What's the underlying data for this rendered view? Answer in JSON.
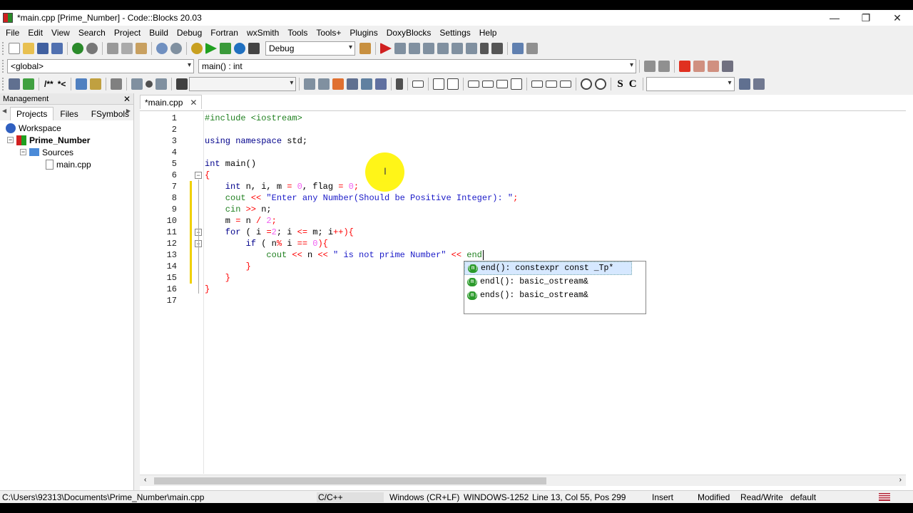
{
  "window": {
    "title": "*main.cpp [Prime_Number] - Code::Blocks 20.03",
    "minimize_icon": "—",
    "restore_icon": "❐",
    "close_icon": "✕"
  },
  "menu": [
    "File",
    "Edit",
    "View",
    "Search",
    "Project",
    "Build",
    "Debug",
    "Fortran",
    "wxSmith",
    "Tools",
    "Tools+",
    "Plugins",
    "DoxyBlocks",
    "Settings",
    "Help"
  ],
  "toolbar": {
    "build_target": "Debug",
    "scope": "<global>",
    "function": "main() : int",
    "doxy_text_1": "/**",
    "doxy_text_2": "*<",
    "bold_s": "S",
    "bold_c": "C"
  },
  "management": {
    "title": "Management",
    "close": "✕",
    "tabs": [
      "Projects",
      "Files",
      "FSymbols"
    ],
    "tree": {
      "workspace": "Workspace",
      "project": "Prime_Number",
      "sources": "Sources",
      "file": "main.cpp"
    }
  },
  "editor": {
    "tab_label": "*main.cpp",
    "tab_close": "✕",
    "line_numbers": [
      "1",
      "2",
      "3",
      "4",
      "5",
      "6",
      "7",
      "8",
      "9",
      "10",
      "11",
      "12",
      "13",
      "14",
      "15",
      "16",
      "17"
    ],
    "code": {
      "l1": "#include <iostream>",
      "l3a": "using namespace",
      "l3b": " std;",
      "l5a": "int",
      "l5b": " main()",
      "l6": "{",
      "l7a": "    int",
      "l7b": " n, i, m ",
      "l7c": "=",
      "l7d": " 0",
      "l7e": ", flag ",
      "l7f": "=",
      "l7g": " 0",
      "l7h": ";",
      "l8a": "    cout ",
      "l8b": "<<",
      "l8c": " \"Enter any Number(Should be Positive Integer): \"",
      "l8d": ";",
      "l9a": "    cin ",
      "l9b": ">>",
      "l9c": " n;",
      "l10a": "    m ",
      "l10b": "=",
      "l10c": " n ",
      "l10d": "/",
      "l10e": " 2",
      "l10f": ";",
      "l11a": "    for",
      "l11b": " ( i ",
      "l11c": "=",
      "l11d": "2",
      "l11e": "; i ",
      "l11f": "<=",
      "l11g": " m; i",
      "l11h": "++",
      "l11i": "){",
      "l12a": "        if",
      "l12b": " ( n",
      "l12c": "%",
      "l12d": " i ",
      "l12e": "==",
      "l12f": " 0",
      "l12g": "){",
      "l13a": "            cout ",
      "l13b": "<<",
      "l13c": " n ",
      "l13d": "<<",
      "l13e": " \" is not prime Number\" ",
      "l13f": "<<",
      "l13g": " end",
      "l14": "        }",
      "l15": "    }",
      "l16": "}"
    }
  },
  "autocomplete": [
    {
      "icon": "(m)",
      "label": "end(): constexpr const _Tp*"
    },
    {
      "icon": "(m)",
      "label": "endl(): basic_ostream&"
    },
    {
      "icon": "(m)",
      "label": "ends(): basic_ostream&"
    }
  ],
  "status": {
    "path": "C:\\Users\\92313\\Documents\\Prime_Number\\main.cpp",
    "language": "C/C++",
    "eol": "Windows (CR+LF)",
    "encoding": "WINDOWS-1252",
    "position": "Line 13, Col 55, Pos 299",
    "mode": "Insert",
    "modified": "Modified",
    "access": "Read/Write",
    "theme": "default"
  }
}
